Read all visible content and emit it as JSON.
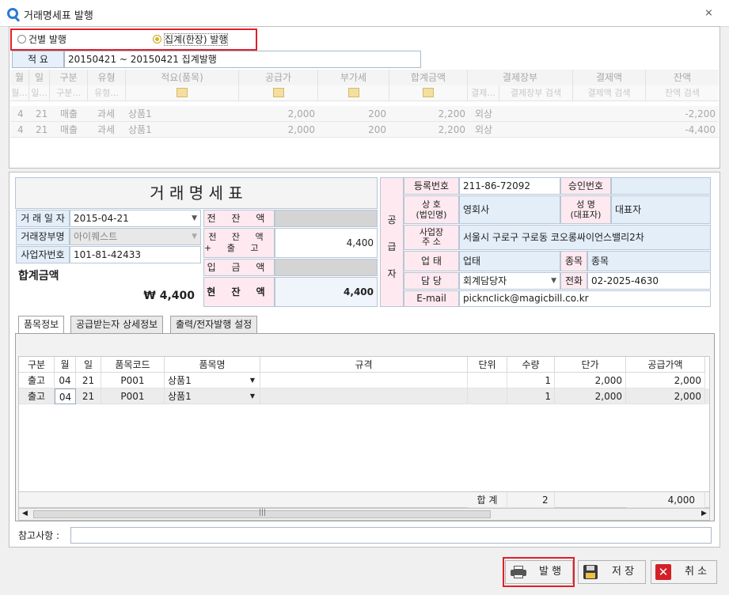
{
  "window": {
    "title": "거래명세표 발행",
    "close": "⨯"
  },
  "mode": {
    "individual": "건별 발행",
    "summary": "집계(한장) 발행"
  },
  "memo": {
    "label": "적 요",
    "value": "20150421 ~ 20150421 집계발행"
  },
  "top_grid": {
    "headers": [
      "월",
      "일",
      "구분",
      "유형",
      "적요(품목)",
      "공급가",
      "부가세",
      "합계금액",
      "결제장부",
      "결제액",
      "잔액"
    ],
    "filters": [
      "월...",
      "일...",
      "구분...",
      "유형...",
      "",
      "",
      "",
      "",
      "결제...",
      "결제장부 검색",
      "결제액 검색",
      "잔액 검색"
    ],
    "rows": [
      [
        "4",
        "21",
        "매출",
        "과세",
        "상품1",
        "2,000",
        "200",
        "2,200",
        "외상",
        "",
        "-2,200"
      ],
      [
        "4",
        "21",
        "매출",
        "과세",
        "상품1",
        "2,000",
        "200",
        "2,200",
        "외상",
        "",
        "-4,400"
      ]
    ]
  },
  "invoice": {
    "title": "거 래 명 세 표",
    "date_label": "거 래 일 자",
    "date_value": "2015-04-21",
    "book_label": "거래장부명",
    "book_value": "아이퀘스트",
    "bizno_label": "사업자번호",
    "bizno_value": "101-81-42433",
    "total_label": "합계금액",
    "total_value": "₩ 4,400",
    "prev_balance_label": "전 잔 액",
    "prev_balance_value": "",
    "prev_plus_label1": "전 잔 액",
    "prev_plus_label2": "+ 출 고 액",
    "prev_plus_value": "4,400",
    "deposit_label": "입 금 액",
    "deposit_value": "",
    "current_label": "현 잔 액",
    "current_value": "4,400"
  },
  "supplier": {
    "side_label": [
      "공",
      "급",
      "자"
    ],
    "reg_label": "등록번호",
    "reg_value": "211-86-72092",
    "approval_label": "승인번호",
    "approval_value": "",
    "company_label1": "상 호",
    "company_label2": "(법인명)",
    "company_value": "영회사",
    "ceo_label1": "성 명",
    "ceo_label2": "(대표자)",
    "ceo_value": "대표자",
    "addr_label1": "사업장",
    "addr_label2": "주 소",
    "addr_value": "서울시 구로구 구로동 코오롱싸이언스밸리2차",
    "biztype_label": "업 태",
    "biztype_value": "업태",
    "item_label": "종목",
    "item_value": "종목",
    "manager_label": "담 당",
    "manager_value": "회계담당자",
    "phone_label": "전화",
    "phone_value": "02-2025-4630",
    "email_label": "E-mail",
    "email_value": "pickncIick@magicbill.co.kr"
  },
  "tabs": [
    "품목정보",
    "공급받는자 상세정보",
    "출력/전자발행 설정"
  ],
  "items_grid": {
    "headers": [
      "구분",
      "월",
      "일",
      "품목코드",
      "품목명",
      "규격",
      "단위",
      "수량",
      "단가",
      "공급가액"
    ],
    "rows": [
      [
        "출고",
        "04",
        "21",
        "P001",
        "상품1",
        "",
        "",
        "1",
        "2,000",
        "2,000"
      ],
      [
        "출고",
        "04",
        "21",
        "P001",
        "상품1",
        "",
        "",
        "1",
        "2,000",
        "2,000"
      ]
    ],
    "total_label": "합 계",
    "total_qty": "2",
    "total_amount": "4,000"
  },
  "note": {
    "label": "참고사항 :",
    "value": ""
  },
  "buttons": {
    "issue": "발 행",
    "save": "저 장",
    "cancel": "취 소"
  },
  "colors": {
    "accent": "#2a7bd1",
    "highlight": "#e0202a",
    "pink": "#fde9ef",
    "blue": "#e3eef9"
  }
}
